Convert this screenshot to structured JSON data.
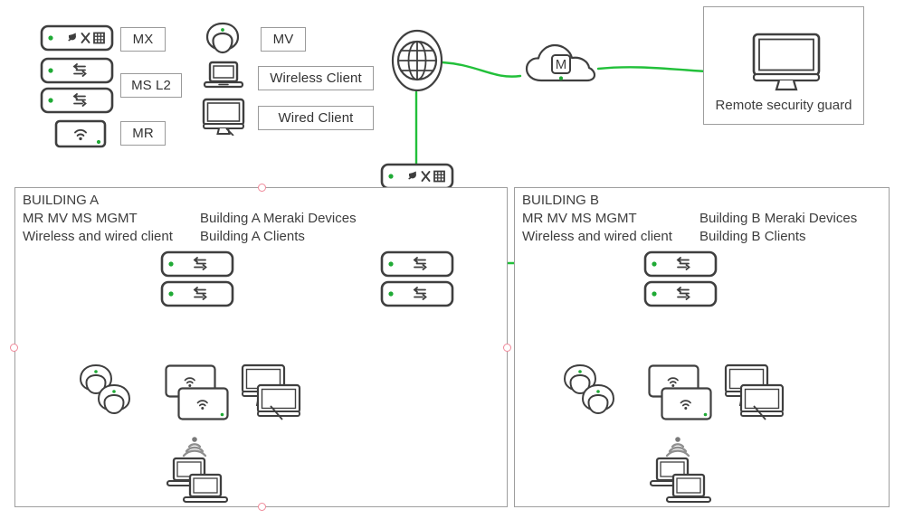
{
  "diagram": {
    "title": "Meraki multi-building network topology",
    "colors": {
      "link_green": "#22c03a",
      "device_outline": "#3f3f3f",
      "box_border": "#9e9e9e",
      "text": "#3d3d3d",
      "status_led": "#1faa35",
      "handle_pink": "#f08a9a"
    }
  },
  "legend": {
    "items": [
      {
        "key": "mx",
        "icon": "mx-appliance-icon",
        "label": "MX"
      },
      {
        "key": "ms_l2",
        "icon": "ms-switch-icon",
        "label": "MS L2"
      },
      {
        "key": "mr",
        "icon": "mr-access-point-icon",
        "label": "MR"
      },
      {
        "key": "mv",
        "icon": "mv-camera-icon",
        "label": "MV"
      },
      {
        "key": "wireless_client",
        "icon": "laptop-icon",
        "label": "Wireless Client"
      },
      {
        "key": "wired_client",
        "icon": "desktop-monitor-icon",
        "label": "Wired Client"
      }
    ]
  },
  "cloud": {
    "internet_icon": "globe-icon",
    "meraki_cloud_icon": "meraki-cloud-icon",
    "meraki_cloud_letter": "M"
  },
  "remote_guard": {
    "label": "Remote security guard",
    "icon": "desktop-monitor-icon"
  },
  "buildings": [
    {
      "id": "a",
      "title": "BUILDING A",
      "line2_left": "MR MV MS MGMT",
      "line3_left": "Wireless and wired client",
      "line2_right": "Building A Meraki Devices",
      "line3_right": "Building A Clients",
      "devices": {
        "switch_top": "ms-switch-icon",
        "switch_bottom": "ms-switch-icon",
        "camera": "mv-camera-stack-icon",
        "access_points": "mr-access-point-stack-icon",
        "wired_clients": "desktop-monitor-stack-icon",
        "wireless_signal": "wifi-signal-icon",
        "wireless_clients": "laptop-stack-icon"
      }
    },
    {
      "id": "b",
      "title": "BUILDING B",
      "line2_left": "MR MV MS MGMT",
      "line3_left": "Wireless and wired client",
      "line2_right": "Building B Meraki Devices",
      "line3_right": "Building B Clients",
      "devices": {
        "switch_top": "ms-switch-icon",
        "switch_bottom": "ms-switch-icon",
        "camera": "mv-camera-stack-icon",
        "access_points": "mr-access-point-stack-icon",
        "wired_clients": "desktop-monitor-stack-icon",
        "wireless_signal": "wifi-signal-icon",
        "wireless_clients": "laptop-stack-icon"
      }
    }
  ],
  "core": {
    "mx_icon": "mx-appliance-icon",
    "switch_top_icon": "ms-switch-icon",
    "switch_bottom_icon": "ms-switch-icon"
  }
}
